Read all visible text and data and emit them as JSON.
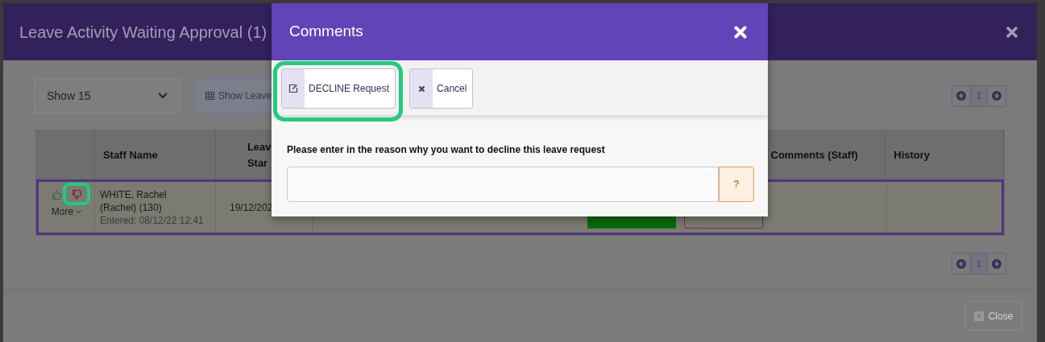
{
  "approval_modal": {
    "title": "Leave Activity Waiting Approval (1)",
    "page_size": "Show 15",
    "show_leave_button": "Show Leave",
    "pagination_top": {
      "page": "1"
    },
    "pagination_bottom": {
      "page": "1"
    },
    "close_button": "Close"
  },
  "table": {
    "columns": [
      {
        "lines": [
          "Staff Name"
        ]
      },
      {
        "lines": [
          "Leav",
          "Star"
        ]
      },
      {
        "lines": [
          "Comments (Staff)"
        ]
      },
      {
        "lines": [
          "History"
        ]
      }
    ],
    "rows": [
      {
        "selected": true,
        "decline_highlighted": true,
        "more": "More",
        "staff_name": "WHITE, Rachel (Rachel) (130)",
        "entered": "Entered: 08/12/22 12:41",
        "leave_start": "19/12/202"
      }
    ]
  },
  "comments_dialog": {
    "title": "Comments",
    "buttons": [
      {
        "kind": "decline",
        "label": "DECLINE Request",
        "highlighted": true
      },
      {
        "kind": "cancel",
        "label": "Cancel",
        "highlighted": false
      }
    ],
    "prompt": "Please enter in the reason why you want to decline this leave request",
    "help_button": "?"
  }
}
